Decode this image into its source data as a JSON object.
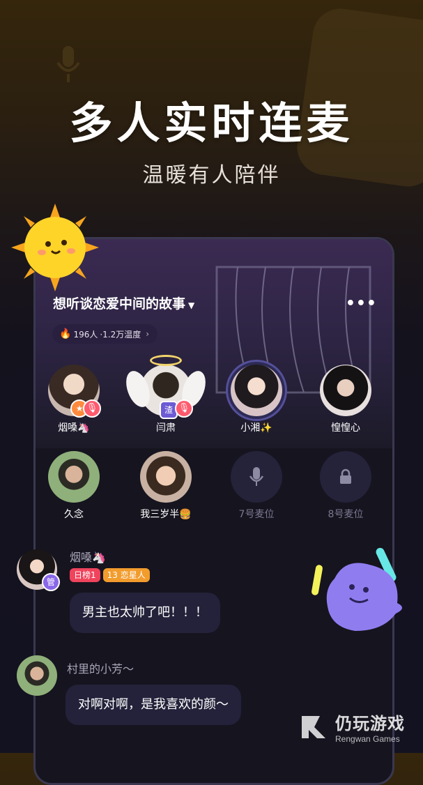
{
  "headline": "多人实时连麦",
  "subline": "温暖有人陪伴",
  "room": {
    "title": "想听谈恋爱中间的故事",
    "stats_count": "196人",
    "stats_heat": "·1.2万温度",
    "more": "•••"
  },
  "seats": [
    {
      "name": "烟嗓🦄"
    },
    {
      "name": "闫肃",
      "role_badge": "渣"
    },
    {
      "name": "小湘✨"
    },
    {
      "name": "惶惶心"
    },
    {
      "name": "久念"
    },
    {
      "name": "我三岁半🍔"
    },
    {
      "name": "7号麦位"
    },
    {
      "name": "8号麦位"
    }
  ],
  "messages": [
    {
      "name": "烟嗓🦄",
      "badge": "管",
      "tags": [
        "日榜1",
        "13 恋星人"
      ],
      "text": "男主也太帅了吧！！！"
    },
    {
      "name": "村里的小芳～",
      "text": "对啊对啊，是我喜欢的颜～"
    }
  ],
  "watermark": {
    "cn": "仍玩游戏",
    "en": "Rengwan Games"
  },
  "colors": {
    "accent_tag_rank": "#f0435c",
    "accent_tag_lover": "#f29c2d",
    "mute_badge": "#ff5a6e"
  }
}
